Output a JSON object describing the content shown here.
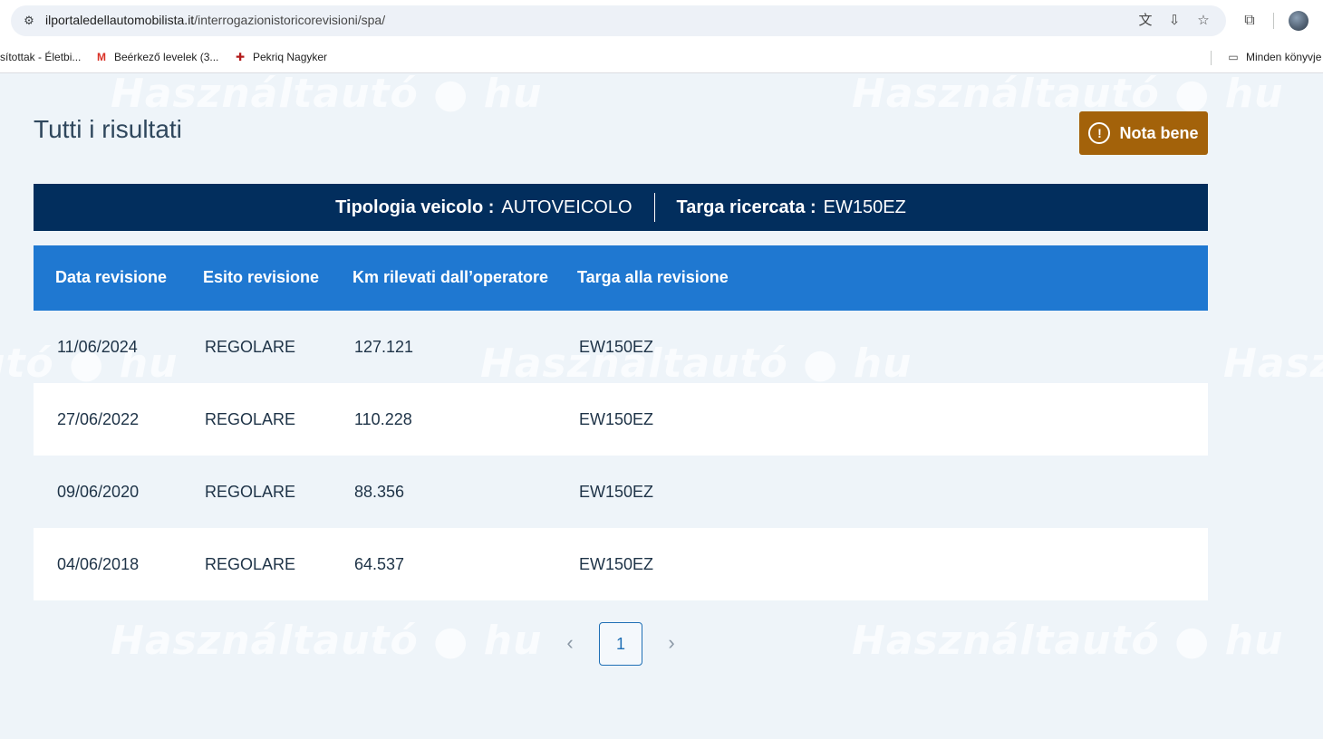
{
  "browser": {
    "url_host": "ilportaledellautomobilista.it",
    "url_path": "/interrogazionistoricorevisioni/spa/",
    "icons": [
      "site-info-icon",
      "translate-icon",
      "install-icon",
      "star-icon",
      "extensions-icon",
      "profile-avatar"
    ],
    "bookmarks": [
      {
        "label": "sítottak - Életbi...",
        "icon": ""
      },
      {
        "label": "Beérkező levelek (3...",
        "icon": "gmail-icon"
      },
      {
        "label": "Pekriq Nagyker",
        "icon": "pekriq-icon"
      }
    ],
    "all_bookmarks": "Minden könyvje"
  },
  "watermark_text": "Használtautó ● hu",
  "page": {
    "title": "Tutti i risultati",
    "nota_button": "Nota bene",
    "info": {
      "tipologia_label": "Tipologia veicolo :",
      "tipologia_value": "AUTOVEICOLO",
      "targa_label": "Targa ricercata :",
      "targa_value": "EW150EZ"
    },
    "table": {
      "headers": [
        "Data revisione",
        "Esito revisione",
        "Km rilevati dall’operatore",
        "Targa alla revisione"
      ],
      "rows": [
        [
          "11/06/2024",
          "REGOLARE",
          "127.121",
          "EW150EZ"
        ],
        [
          "27/06/2022",
          "REGOLARE",
          "110.228",
          "EW150EZ"
        ],
        [
          "09/06/2020",
          "REGOLARE",
          "88.356",
          "EW150EZ"
        ],
        [
          "04/06/2018",
          "REGOLARE",
          "64.537",
          "EW150EZ"
        ]
      ]
    },
    "pagination": {
      "current_page": "1",
      "prev_symbol": "‹",
      "next_symbol": "›"
    }
  }
}
